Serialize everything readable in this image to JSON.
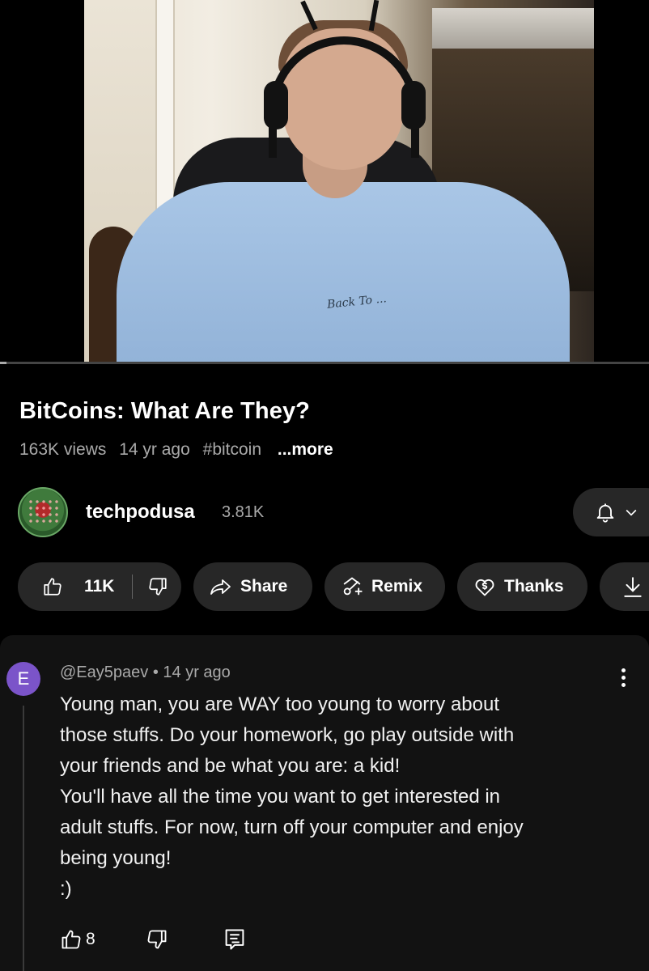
{
  "video": {
    "title": "BitCoins:  What Are They?",
    "views": "163K views",
    "age": "14 yr ago",
    "hashtag": "#bitcoin",
    "more_label": "...more",
    "shirt_print": "Back To ..."
  },
  "channel": {
    "name": "techpodusa",
    "subscribers": "3.81K",
    "bell_icon": "bell-icon"
  },
  "actions": {
    "likes": "11K",
    "share_label": "Share",
    "remix_label": "Remix",
    "thanks_label": "Thanks"
  },
  "comment": {
    "avatar_letter": "E",
    "avatar_color": "#7b54c9",
    "author": "@Eay5paev",
    "separator": "•",
    "age": "14 yr ago",
    "lines": [
      "Young man, you are WAY too young to worry about",
      "those stuffs.  Do your homework, go play outside with",
      "your friends and be what you are:  a kid!",
      "You'll have all the time you want to get interested in",
      "adult stuffs.  For now, turn off your computer and enjoy",
      "being young!",
      ":)"
    ],
    "like_count": "8"
  }
}
